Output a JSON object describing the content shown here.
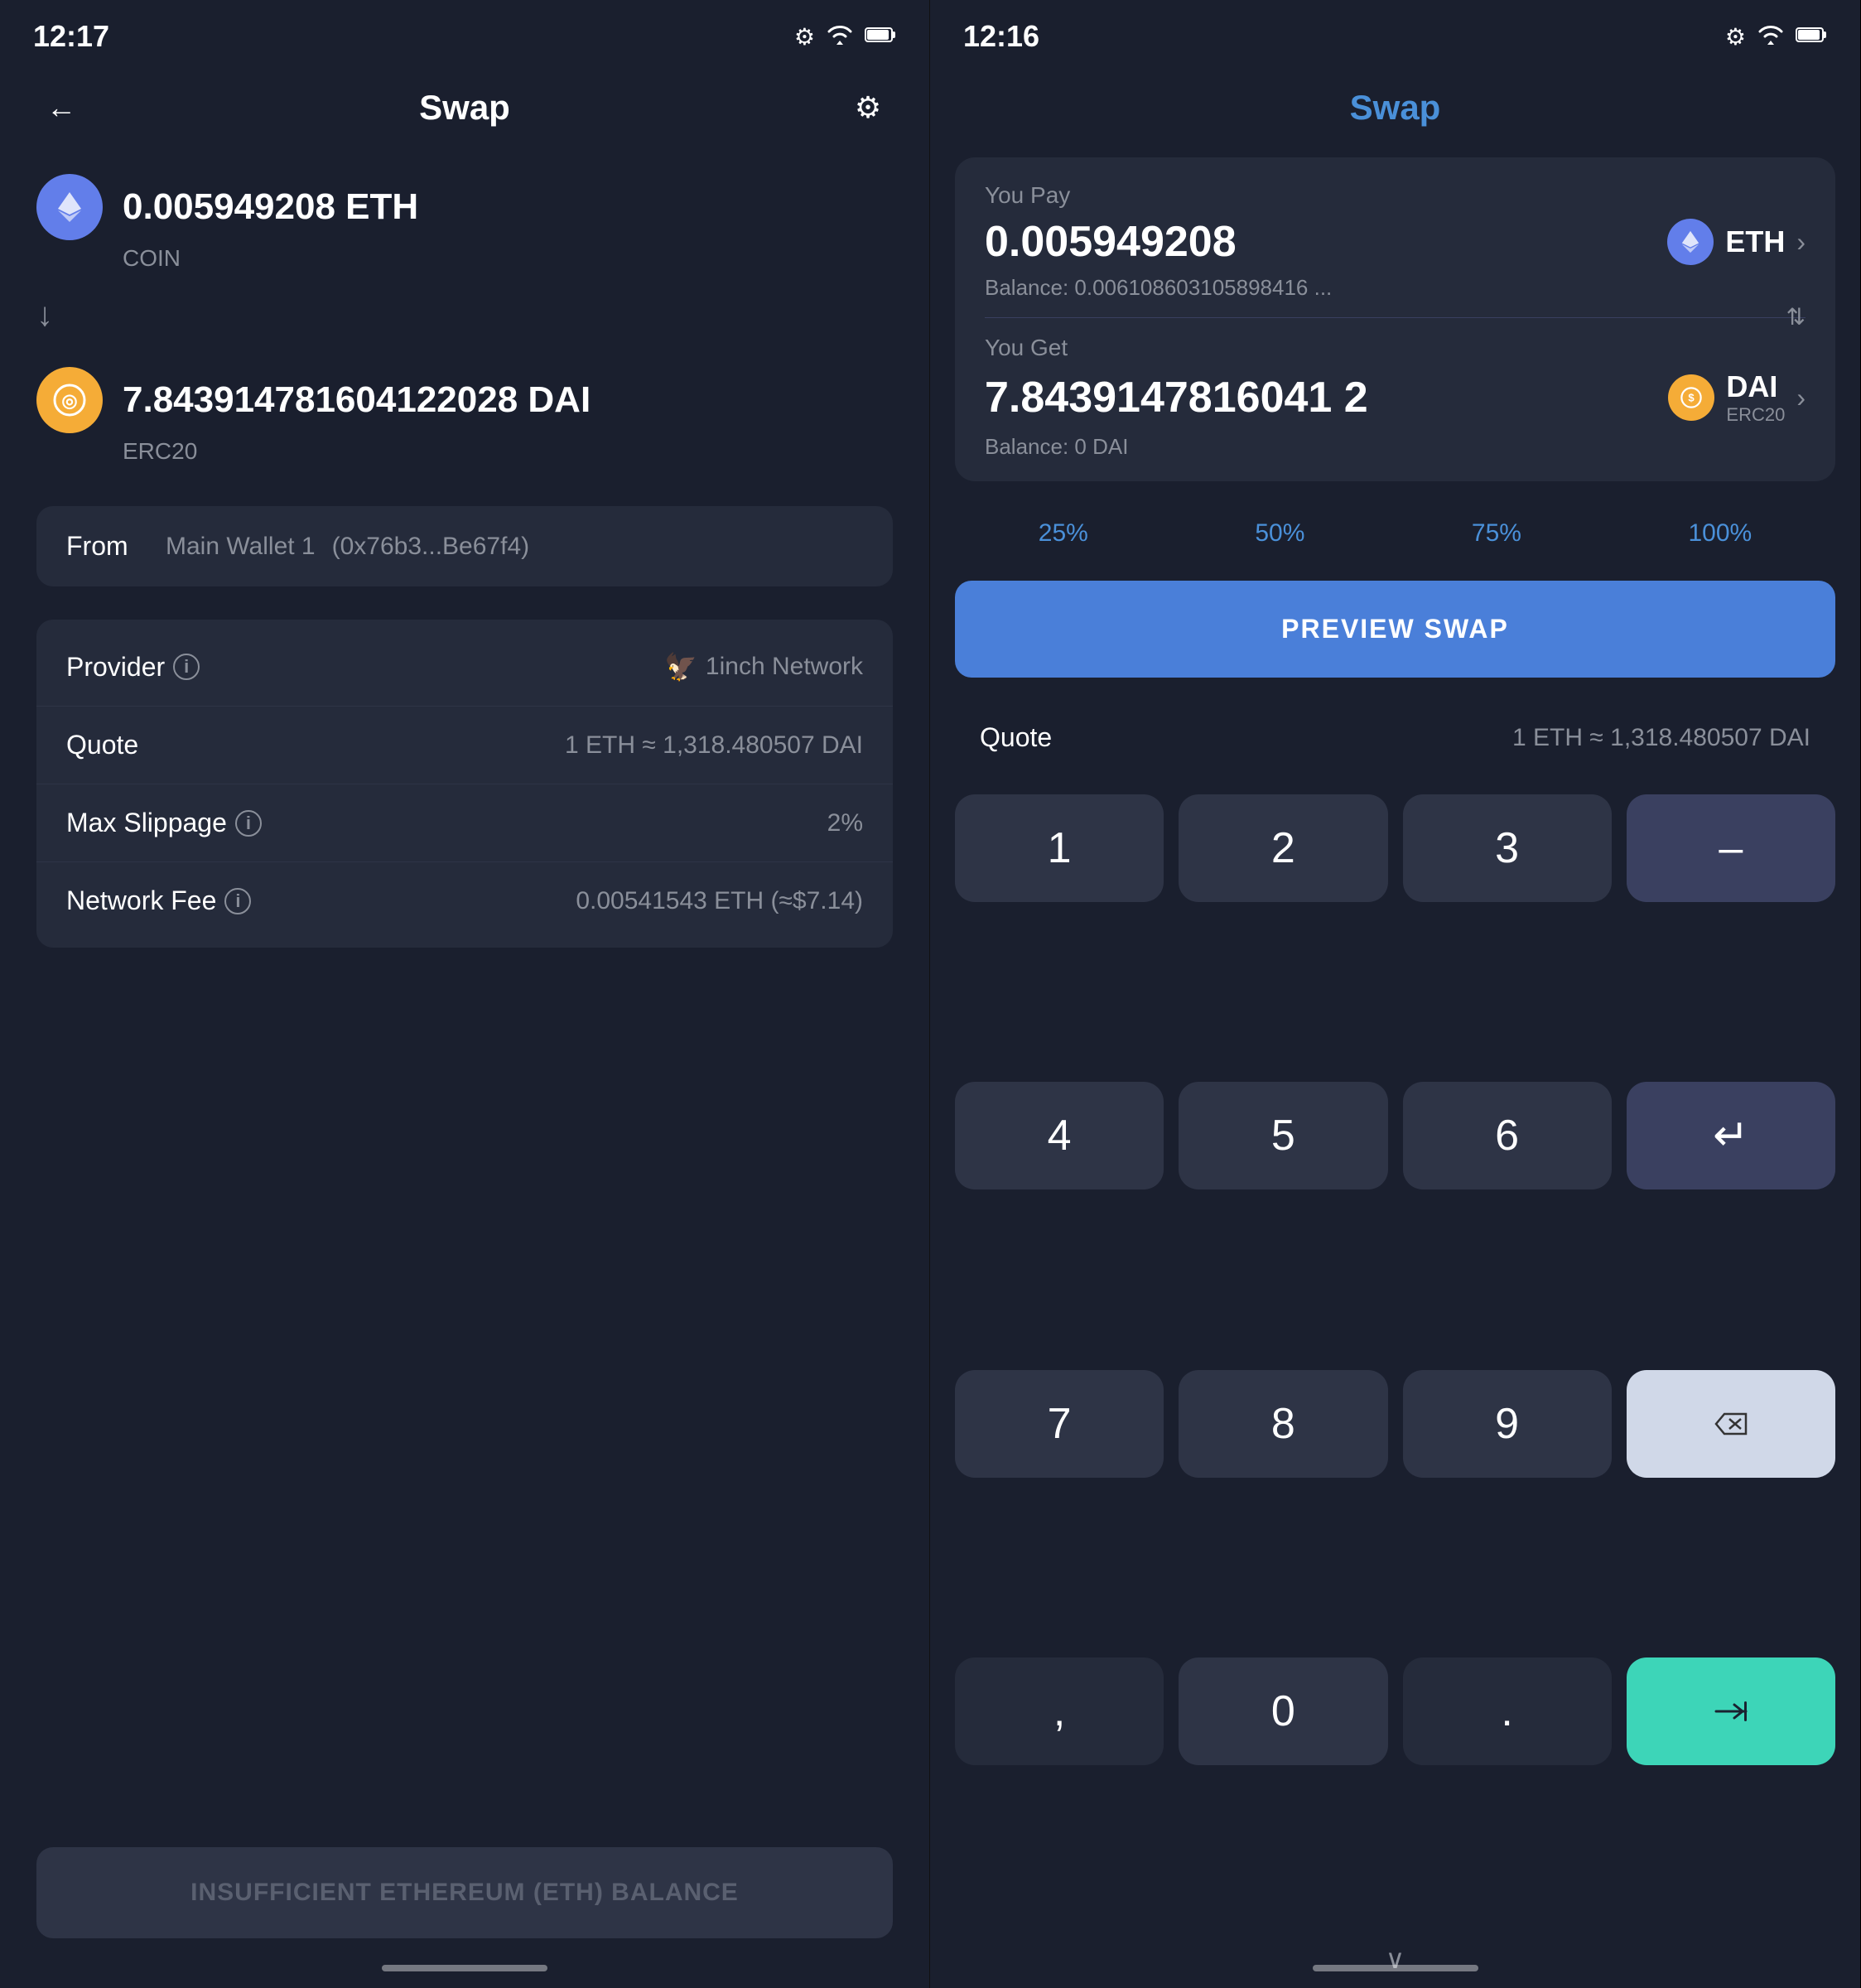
{
  "left": {
    "status": {
      "time": "12:17",
      "icons": [
        "⚙",
        "▲",
        "🔋"
      ]
    },
    "header": {
      "back_label": "←",
      "title": "Swap",
      "settings_label": "⚙"
    },
    "from_coin": {
      "amount": "0.005949208 ETH",
      "type": "COIN",
      "icon": "◆"
    },
    "to_coin": {
      "amount": "7.843914781604122028 DAI",
      "type": "ERC20",
      "icon": "◎"
    },
    "from_wallet": {
      "label": "From",
      "wallet_name": "Main Wallet 1",
      "wallet_addr": "(0x76b3...Be67f4)"
    },
    "details": {
      "provider_label": "Provider",
      "provider_info": "i",
      "provider_value": "1inch Network",
      "quote_label": "Quote",
      "quote_value": "1 ETH ≈ 1,318.480507 DAI",
      "slippage_label": "Max Slippage",
      "slippage_info": "i",
      "slippage_value": "2%",
      "fee_label": "Network Fee",
      "fee_info": "i",
      "fee_value": "0.00541543 ETH (≈$7.14)"
    },
    "bottom_btn": "INSUFFICIENT ETHEREUM (ETH) BALANCE"
  },
  "right": {
    "status": {
      "time": "12:16",
      "icons": [
        "⚙",
        "▲",
        "🔋"
      ]
    },
    "header": {
      "title": "Swap"
    },
    "you_pay": {
      "label": "You Pay",
      "amount": "0.005949208",
      "token": "ETH",
      "token_icon": "◆",
      "balance": "Balance: 0.006108603105898416 ..."
    },
    "you_get": {
      "label": "You Get",
      "amount": "7.8439147816041 2",
      "token": "DAI",
      "token_type": "ERC20",
      "token_icon": "◎",
      "balance": "Balance: 0 DAI"
    },
    "pct_buttons": [
      "25%",
      "50%",
      "75%",
      "100%"
    ],
    "preview_btn": "PREVIEW SWAP",
    "quote": {
      "label": "Quote",
      "value": "1 ETH ≈ 1,318.480507 DAI"
    },
    "numpad": {
      "keys": [
        [
          "1",
          "2",
          "3",
          "—"
        ],
        [
          "4",
          "5",
          "6",
          "↵"
        ],
        [
          "7",
          "8",
          "9",
          "⌫"
        ],
        [
          ",",
          "0",
          ".",
          "→|"
        ]
      ]
    }
  }
}
